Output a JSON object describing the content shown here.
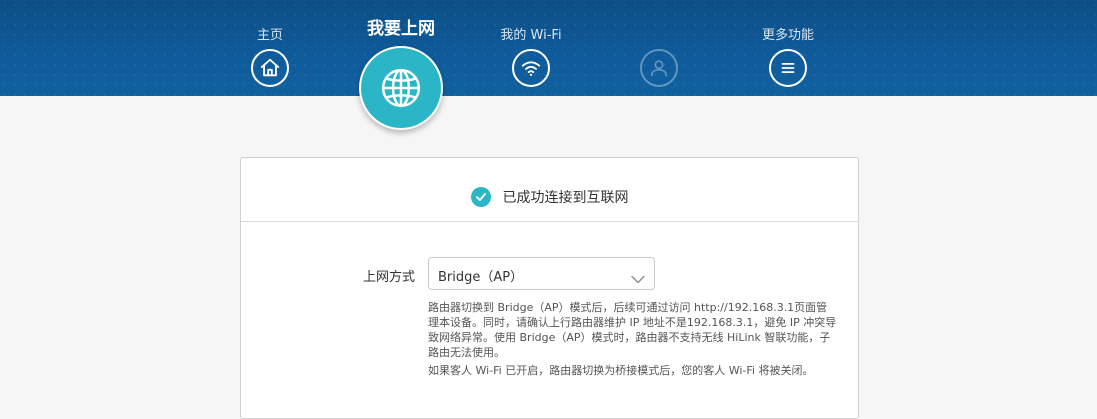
{
  "nav": {
    "home": {
      "label": "主页",
      "icon": "home-icon"
    },
    "internet": {
      "label": "我要上网",
      "icon": "globe-icon"
    },
    "wifi": {
      "label": "我的 Wi-Fi",
      "icon": "wifi-icon"
    },
    "user": {
      "label": "",
      "icon": "user-icon"
    },
    "more": {
      "label": "更多功能",
      "icon": "menu-icon"
    }
  },
  "status": {
    "text": "已成功连接到互联网",
    "icon": "check-circle-icon"
  },
  "form": {
    "mode_label": "上网方式",
    "mode_value": "Bridge（AP）"
  },
  "notes": {
    "line1": "路由器切换到 Bridge（AP）模式后，后续可通过访问 http://192.168.3.1页面管理本设备。同时，请确认上行路由器维护 IP 地址不是192.168.3.1，避免 IP 冲突导致网络异常。使用 Bridge（AP）模式时，路由器不支持无线 HiLink 智联功能，子路由无法使用。",
    "line2": "如果客人 Wi-Fi 已开启，路由器切换为桥接模式后，您的客人 Wi-Fi 将被关闭。"
  },
  "colors": {
    "header": "#0f5b9b",
    "accent": "#2ab6c6"
  }
}
